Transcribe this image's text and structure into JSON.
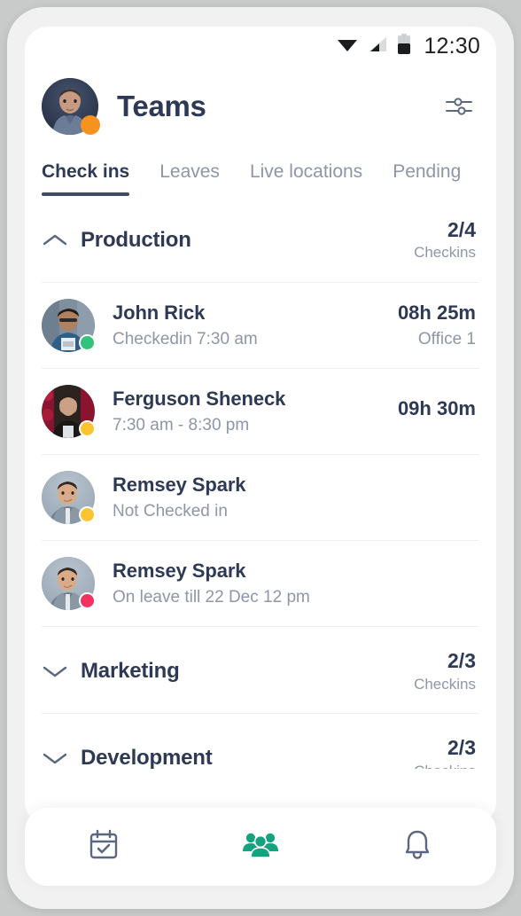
{
  "colors": {
    "accent_teal": "#13a37e",
    "title_navy": "#2e3a55",
    "muted": "#8e96a8",
    "badge_orange": "#f6921e",
    "status_green": "#31c27c",
    "status_yellow": "#fcc431",
    "status_pink": "#f2325f",
    "frame_gray": "#c9cbcb"
  },
  "status_bar": {
    "time": "12:30",
    "wifi_icon": "wifi-icon",
    "signal_icon": "cellular-signal-icon",
    "battery_icon": "battery-icon"
  },
  "header": {
    "title": "Teams",
    "avatar_name": "user-avatar",
    "avatar_badge_status": "away",
    "filter_icon": "filter-sliders-icon"
  },
  "tabs": [
    {
      "label": "Check ins",
      "active": true
    },
    {
      "label": "Leaves",
      "active": false
    },
    {
      "label": "Live locations",
      "active": false
    },
    {
      "label": "Pending",
      "active": false
    }
  ],
  "groups": [
    {
      "name": "Production",
      "count": "2/4",
      "count_label": "Checkins",
      "expanded": true,
      "chevron": "chevron-up-icon",
      "members": [
        {
          "name": "John Rick",
          "sub": "Checkedin 7:30 am",
          "duration": "08h 25m",
          "location": "Office 1",
          "status": "green"
        },
        {
          "name": "Ferguson Sheneck",
          "sub": "7:30 am - 8:30 pm",
          "duration": "09h 30m",
          "location": "",
          "status": "yellow"
        },
        {
          "name": "Remsey Spark",
          "sub": "Not Checked in",
          "duration": "",
          "location": "",
          "status": "yellow"
        },
        {
          "name": "Remsey Spark",
          "sub": "On leave till 22 Dec 12 pm",
          "duration": "",
          "location": "",
          "status": "pink"
        }
      ]
    },
    {
      "name": "Marketing",
      "count": "2/3",
      "count_label": "Checkins",
      "expanded": false,
      "chevron": "chevron-down-icon",
      "members": []
    },
    {
      "name": "Development",
      "count": "2/3",
      "count_label": "Checkins",
      "expanded": false,
      "chevron": "chevron-down-icon",
      "members": []
    }
  ],
  "bottom_nav": [
    {
      "icon": "calendar-check-icon",
      "active": false
    },
    {
      "icon": "people-teams-icon",
      "active": true
    },
    {
      "icon": "bell-notification-icon",
      "active": false
    }
  ]
}
